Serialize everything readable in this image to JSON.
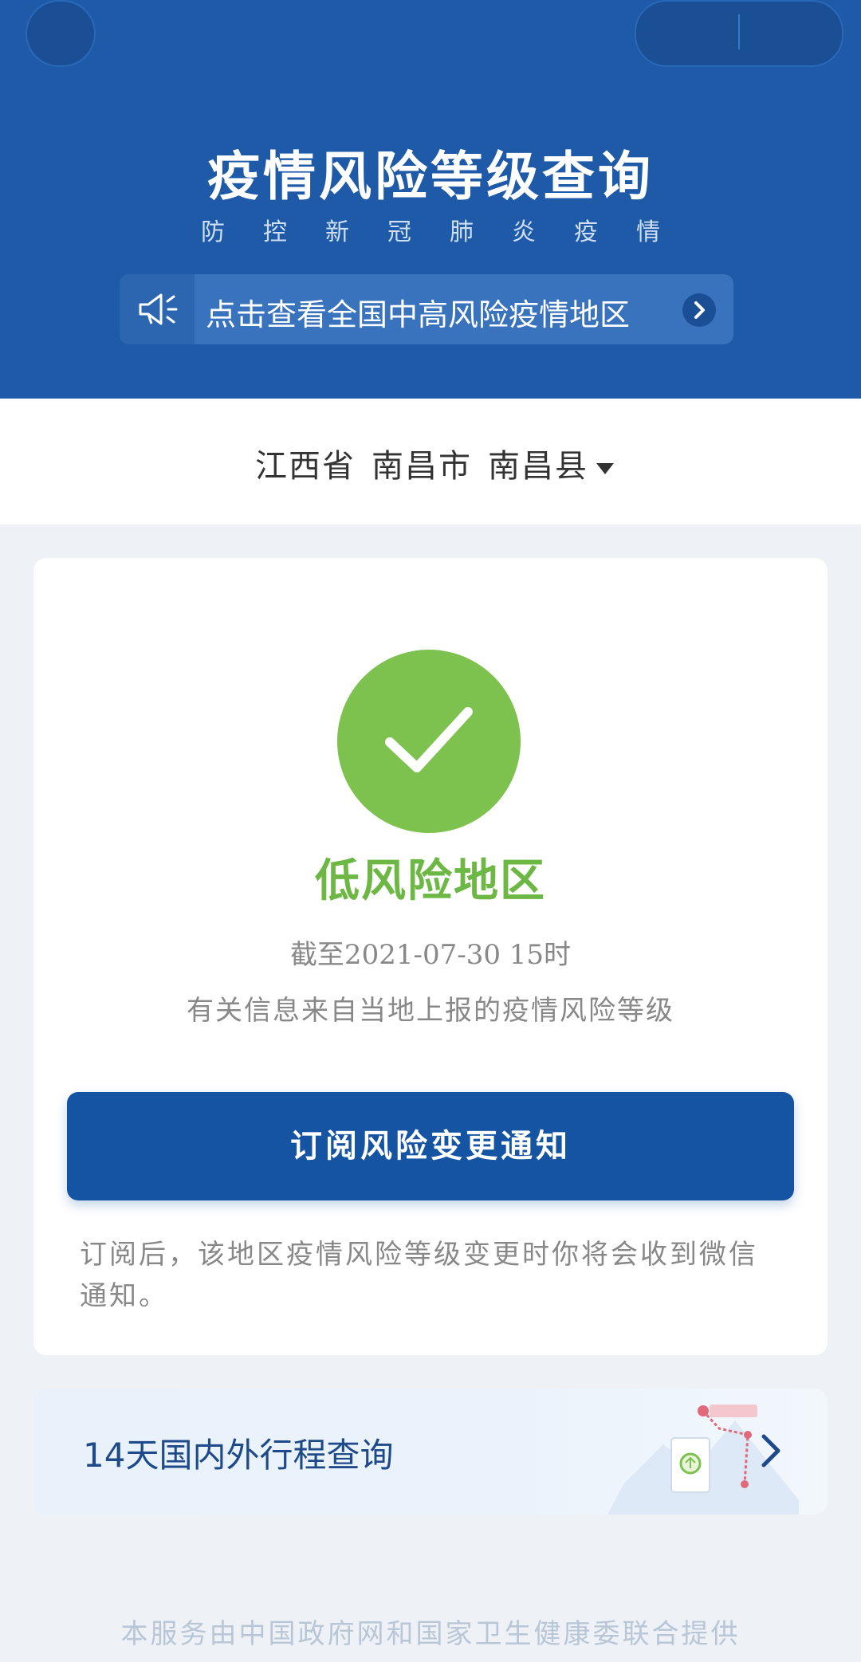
{
  "header": {
    "title": "疫情风险等级查询",
    "subtitle": "防控新冠肺炎疫情",
    "notice": "点击查看全国中高风险疫情地区"
  },
  "location": {
    "province": "江西省",
    "city": "南昌市",
    "county": "南昌县"
  },
  "result": {
    "level": "低风险地区",
    "update_time": "截至2021-07-30 15时",
    "info": "有关信息来自当地上报的疫情风险等级",
    "subscribe_button": "订阅风险变更通知",
    "subscribe_note": "订阅后，该地区疫情风险等级变更时你将会收到微信通知。"
  },
  "trip": {
    "label": "14天国内外行程查询"
  },
  "footer": "本服务由中国政府网和国家卫生健康委联合提供",
  "colors": {
    "header_blue": "#1e5aa8",
    "low_risk_green": "#7dc24e",
    "button_blue": "#1554a3"
  }
}
